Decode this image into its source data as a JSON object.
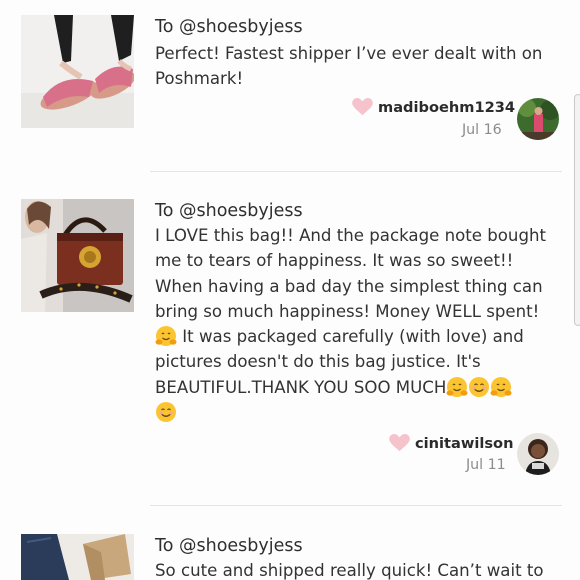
{
  "reviews": [
    {
      "to": "To @shoesbyjess",
      "lines": [
        "Perfect! Fastest shipper I’ve ever dealt with on",
        "Poshmark!"
      ],
      "username": "madiboehm1234",
      "date": "Jul 16",
      "thumbnail": "pink-slide-sandals",
      "colors": {
        "heart": "#f6c3cc"
      }
    },
    {
      "to": "To @shoesbyjess",
      "lines": [
        "I LOVE this bag!! And the package note bought",
        "me to tears of happiness. It was so sweet!!",
        "When having a bad day the simplest thing can",
        "bring so much happiness! Money WELL spent!",
        " It was packaged carefully (with love) and",
        "pictures doesn't do this bag justice. It's",
        "BEAUTIFUL.THANK YOU SOO MUCH"
      ],
      "emoji": [
        "hugging-face-emoji",
        "smiling-face-emoji"
      ],
      "username": "cinitawilson",
      "date": "Jul 11",
      "thumbnail": "brown-lion-handbag",
      "colors": {
        "heart": "#f6c3cc"
      }
    },
    {
      "to": "To @shoesbyjess",
      "lines": [
        "So cute and shipped really quick! Can’t wait to"
      ],
      "thumbnail": "jeans-and-box"
    }
  ]
}
